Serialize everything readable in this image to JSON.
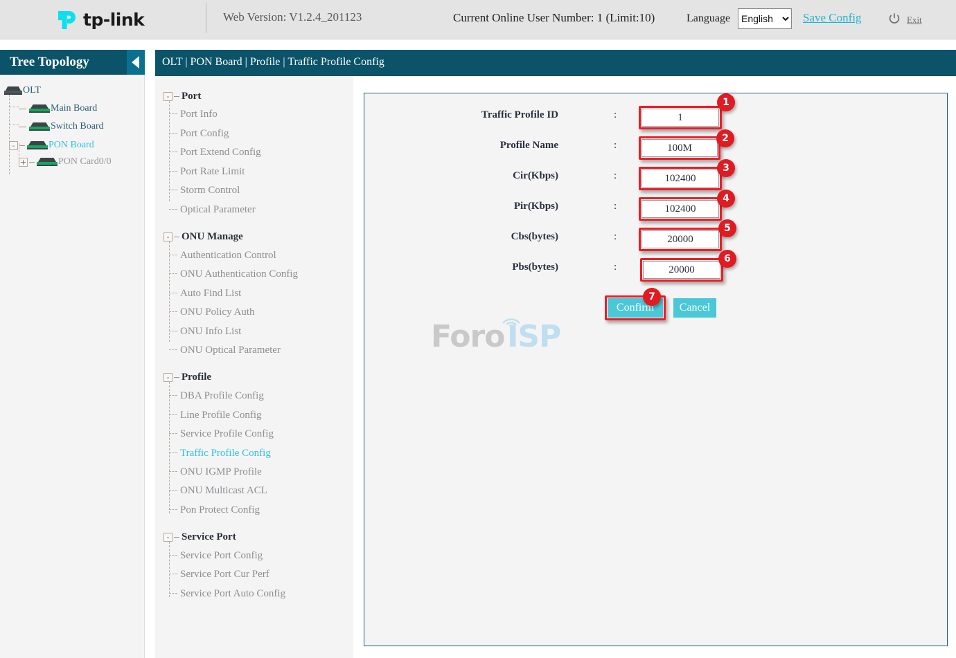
{
  "header": {
    "brand": "tp-link",
    "web_version": "Web Version: V1.2.4_201123",
    "online_users": "Current Online User Number: 1 (Limit:10)",
    "language_label": "Language",
    "language_selected": "English",
    "language_options": [
      "English"
    ],
    "save_config": "Save Config",
    "exit": "Exit",
    "power_icon": "power-icon"
  },
  "tree": {
    "title": "Tree Topology",
    "collapse_icon": "collapse-left-icon",
    "nodes": [
      {
        "label": "OLT",
        "icon": "device-icon",
        "expander": "",
        "active": false
      },
      {
        "label": "Main Board",
        "icon": "device-icon",
        "expander": "",
        "active": false
      },
      {
        "label": "Switch Board",
        "icon": "device-icon",
        "expander": "",
        "active": false
      },
      {
        "label": "PON Board",
        "icon": "device-icon",
        "expander": "-",
        "active": true
      },
      {
        "label": "PON Card0/0",
        "icon": "device-icon",
        "expander": "+",
        "active": false
      }
    ]
  },
  "breadcrumb": "OLT | PON Board | Profile | Traffic Profile Config",
  "menu": {
    "groups": [
      {
        "name": "Port",
        "expander": "-",
        "items": [
          "Port Info",
          "Port Config",
          "Port Extend Config",
          "Port Rate Limit",
          "Storm Control",
          "Optical Parameter"
        ]
      },
      {
        "name": "ONU Manage",
        "expander": "-",
        "items": [
          "Authentication Control",
          "ONU Authentication Config",
          "Auto Find List",
          "ONU Policy Auth",
          "ONU Info List",
          "ONU Optical Parameter"
        ]
      },
      {
        "name": "Profile",
        "expander": "-",
        "items": [
          "DBA Profile Config",
          "Line Profile Config",
          "Service Profile Config",
          "Traffic Profile Config",
          "ONU IGMP Profile",
          "ONU Multicast ACL",
          "Pon Protect Config"
        ]
      },
      {
        "name": "Service Port",
        "expander": "-",
        "items": [
          "Service Port Config",
          "Service Port Cur Perf",
          "Service Port Auto Config"
        ]
      }
    ],
    "active_item": "Traffic Profile Config"
  },
  "form": {
    "fields": [
      {
        "label": "Traffic Profile ID",
        "colon": ":",
        "value": "1",
        "badge": "1"
      },
      {
        "label": "Profile Name",
        "colon": ":",
        "value": "100M",
        "badge": "2"
      },
      {
        "label": "Cir(Kbps)",
        "colon": ":",
        "value": "102400",
        "badge": "3"
      },
      {
        "label": "Pir(Kbps)",
        "colon": ":",
        "value": "102400",
        "badge": "4"
      },
      {
        "label": "Cbs(bytes)",
        "colon": ":",
        "value": "20000",
        "badge": "5"
      },
      {
        "label": "Pbs(bytes)",
        "colon": ":",
        "value": "20000",
        "badge": "6"
      }
    ],
    "confirm_label": "Confirm",
    "cancel_label": "Cancel",
    "confirm_badge": "7"
  },
  "watermark": {
    "part1": "Foro",
    "part2": "ISP"
  },
  "colors": {
    "header_bg": "#e4e4e4",
    "panel_teal": "#0a5369",
    "accent_cyan": "#2ec2e0",
    "button_cyan": "#4ac8d8",
    "highlight_red": "#ee1c24",
    "tplink_cyan": "#0ce0ee"
  }
}
